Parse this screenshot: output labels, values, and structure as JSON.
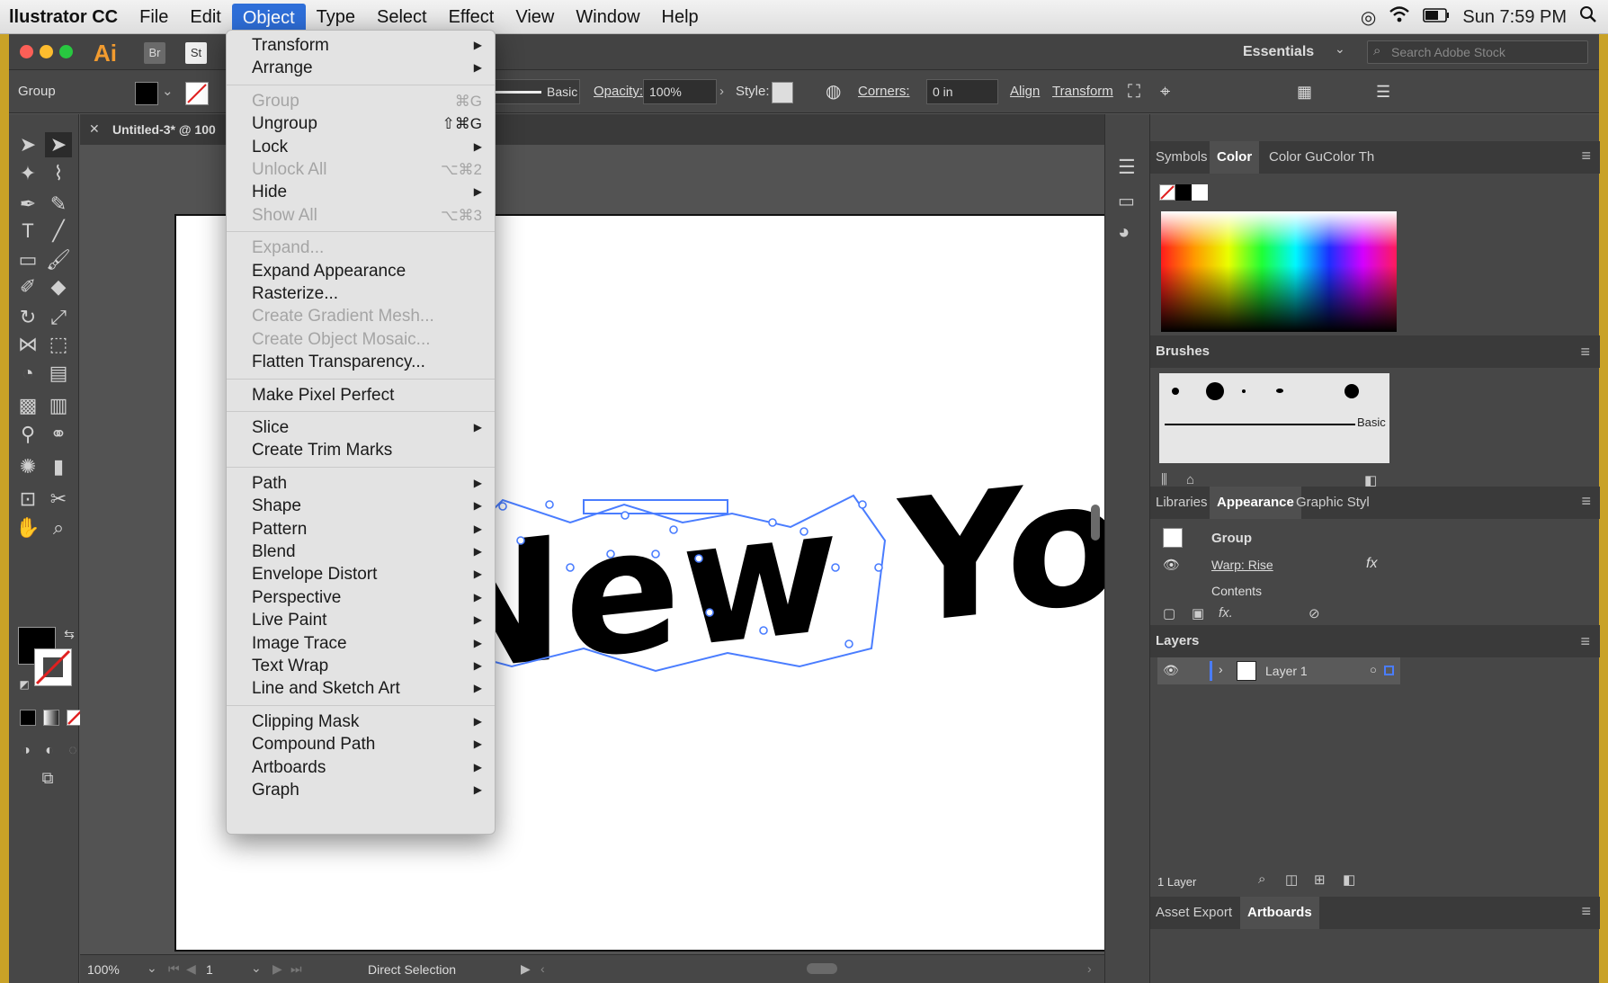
{
  "menubar": {
    "app_name": "llustrator CC",
    "items": [
      "File",
      "Edit",
      "Object",
      "Type",
      "Select",
      "Effect",
      "View",
      "Window",
      "Help"
    ],
    "active_item": "Object",
    "clock": "Sun 7:59 PM"
  },
  "titlebar": {
    "app_icon": "Ai",
    "bridge_label": "Br",
    "stock_label": "St",
    "workspace": "Essentials",
    "search_placeholder": "Search Adobe Stock"
  },
  "control_bar": {
    "selection_label": "Group",
    "stroke_style": "Basic",
    "opacity_label": "Opacity:",
    "opacity_value": "100%",
    "style_label": "Style:",
    "corners_label": "Corners:",
    "corners_value": "0 in",
    "align_label": "Align",
    "transform_label": "Transform"
  },
  "document": {
    "tab_title": "Untitled-3* @ 100",
    "artwork_text": "New York"
  },
  "status_bar": {
    "zoom": "100%",
    "artboard_number": "1",
    "current_tool": "Direct Selection"
  },
  "object_menu": {
    "groups": [
      [
        {
          "label": "Transform",
          "submenu": true,
          "enabled": true
        },
        {
          "label": "Arrange",
          "submenu": true,
          "enabled": true
        }
      ],
      [
        {
          "label": "Group",
          "shortcut": "⌘G",
          "enabled": false
        },
        {
          "label": "Ungroup",
          "shortcut": "⇧⌘G",
          "enabled": true
        },
        {
          "label": "Lock",
          "submenu": true,
          "enabled": true
        },
        {
          "label": "Unlock All",
          "shortcut": "⌥⌘2",
          "enabled": false
        },
        {
          "label": "Hide",
          "submenu": true,
          "enabled": true
        },
        {
          "label": "Show All",
          "shortcut": "⌥⌘3",
          "enabled": false
        }
      ],
      [
        {
          "label": "Expand...",
          "enabled": false
        },
        {
          "label": "Expand Appearance",
          "enabled": true
        },
        {
          "label": "Rasterize...",
          "enabled": true
        },
        {
          "label": "Create Gradient Mesh...",
          "enabled": false
        },
        {
          "label": "Create Object Mosaic...",
          "enabled": false
        },
        {
          "label": "Flatten Transparency...",
          "enabled": true
        }
      ],
      [
        {
          "label": "Make Pixel Perfect",
          "enabled": true
        }
      ],
      [
        {
          "label": "Slice",
          "submenu": true,
          "enabled": true
        },
        {
          "label": "Create Trim Marks",
          "enabled": true
        }
      ],
      [
        {
          "label": "Path",
          "submenu": true,
          "enabled": true
        },
        {
          "label": "Shape",
          "submenu": true,
          "enabled": true
        },
        {
          "label": "Pattern",
          "submenu": true,
          "enabled": true
        },
        {
          "label": "Blend",
          "submenu": true,
          "enabled": true
        },
        {
          "label": "Envelope Distort",
          "submenu": true,
          "enabled": true
        },
        {
          "label": "Perspective",
          "submenu": true,
          "enabled": true
        },
        {
          "label": "Live Paint",
          "submenu": true,
          "enabled": true
        },
        {
          "label": "Image Trace",
          "submenu": true,
          "enabled": true
        },
        {
          "label": "Text Wrap",
          "submenu": true,
          "enabled": true
        },
        {
          "label": "Line and Sketch Art",
          "submenu": true,
          "enabled": true
        }
      ],
      [
        {
          "label": "Clipping Mask",
          "submenu": true,
          "enabled": true
        },
        {
          "label": "Compound Path",
          "submenu": true,
          "enabled": true
        },
        {
          "label": "Artboards",
          "submenu": true,
          "enabled": true
        },
        {
          "label": "Graph",
          "submenu": true,
          "enabled": true
        }
      ]
    ]
  },
  "panels": {
    "color_tabs": [
      "Symbols",
      "Color",
      "Color Gu",
      "Color Th"
    ],
    "color_active": "Color",
    "brushes_title": "Brushes",
    "brush_basic_label": "Basic",
    "appearance_tabs": [
      "Libraries",
      "Appearance",
      "Graphic Styl"
    ],
    "appearance_active": "Appearance",
    "appearance_group": "Group",
    "appearance_effect": "Warp: Rise",
    "appearance_contents": "Contents",
    "layers_title": "Layers",
    "layer_name": "Layer 1",
    "layers_count": "1 Layer",
    "bottom_tabs": [
      "Asset Export",
      "Artboards"
    ],
    "bottom_active": "Artboards"
  },
  "colors": {
    "menu_highlight": "#2e6ed8",
    "ui_dark": "#474747",
    "canvas": "#535353",
    "selection_blue": "#4a7dff"
  }
}
